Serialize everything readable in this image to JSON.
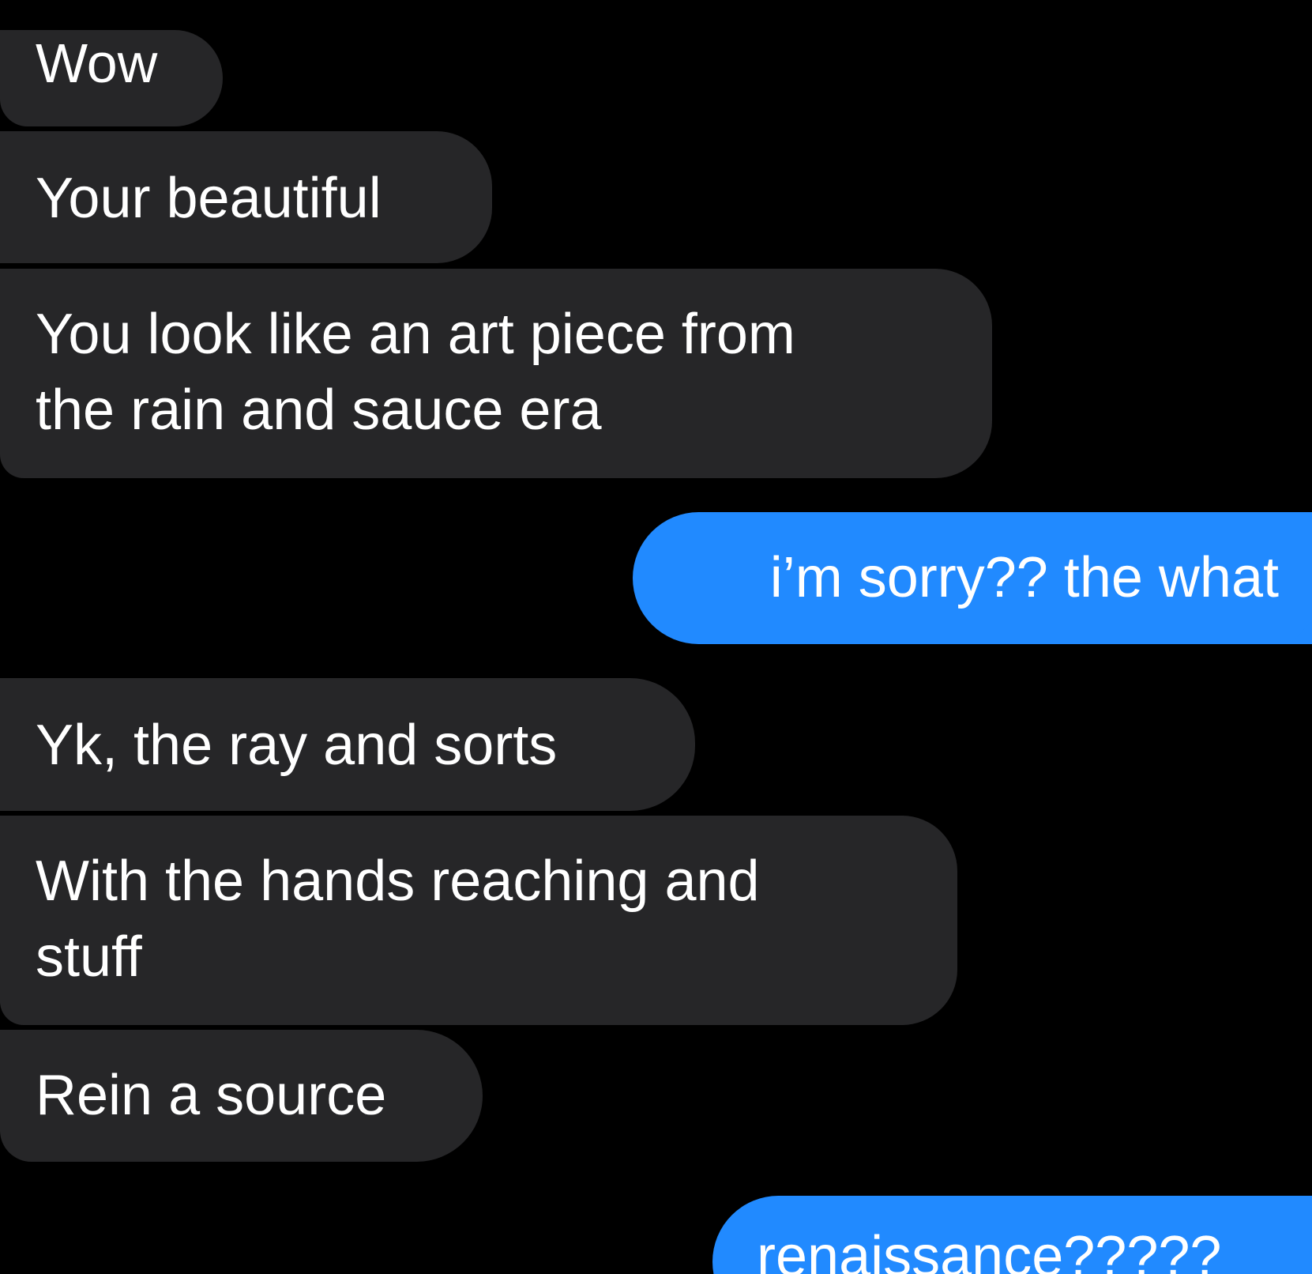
{
  "conversation": {
    "messages": [
      {
        "sender": "them",
        "text": "Wow"
      },
      {
        "sender": "them",
        "text": "Your beautiful"
      },
      {
        "sender": "them",
        "text": "You look like an art piece from",
        "text_line2": "the rain and sauce era"
      },
      {
        "sender": "me",
        "text": "i’m sorry?? the what"
      },
      {
        "sender": "them",
        "text": "Yk, the ray and sorts"
      },
      {
        "sender": "them",
        "text": "With the hands reaching and",
        "text_line2": "stuff"
      },
      {
        "sender": "them",
        "text": "Rein a source"
      },
      {
        "sender": "me",
        "text": "renaissance?????"
      }
    ]
  },
  "colors": {
    "background": "#000000",
    "received_bubble": "#262628",
    "sent_bubble": "#218aff",
    "text": "#ffffff"
  }
}
